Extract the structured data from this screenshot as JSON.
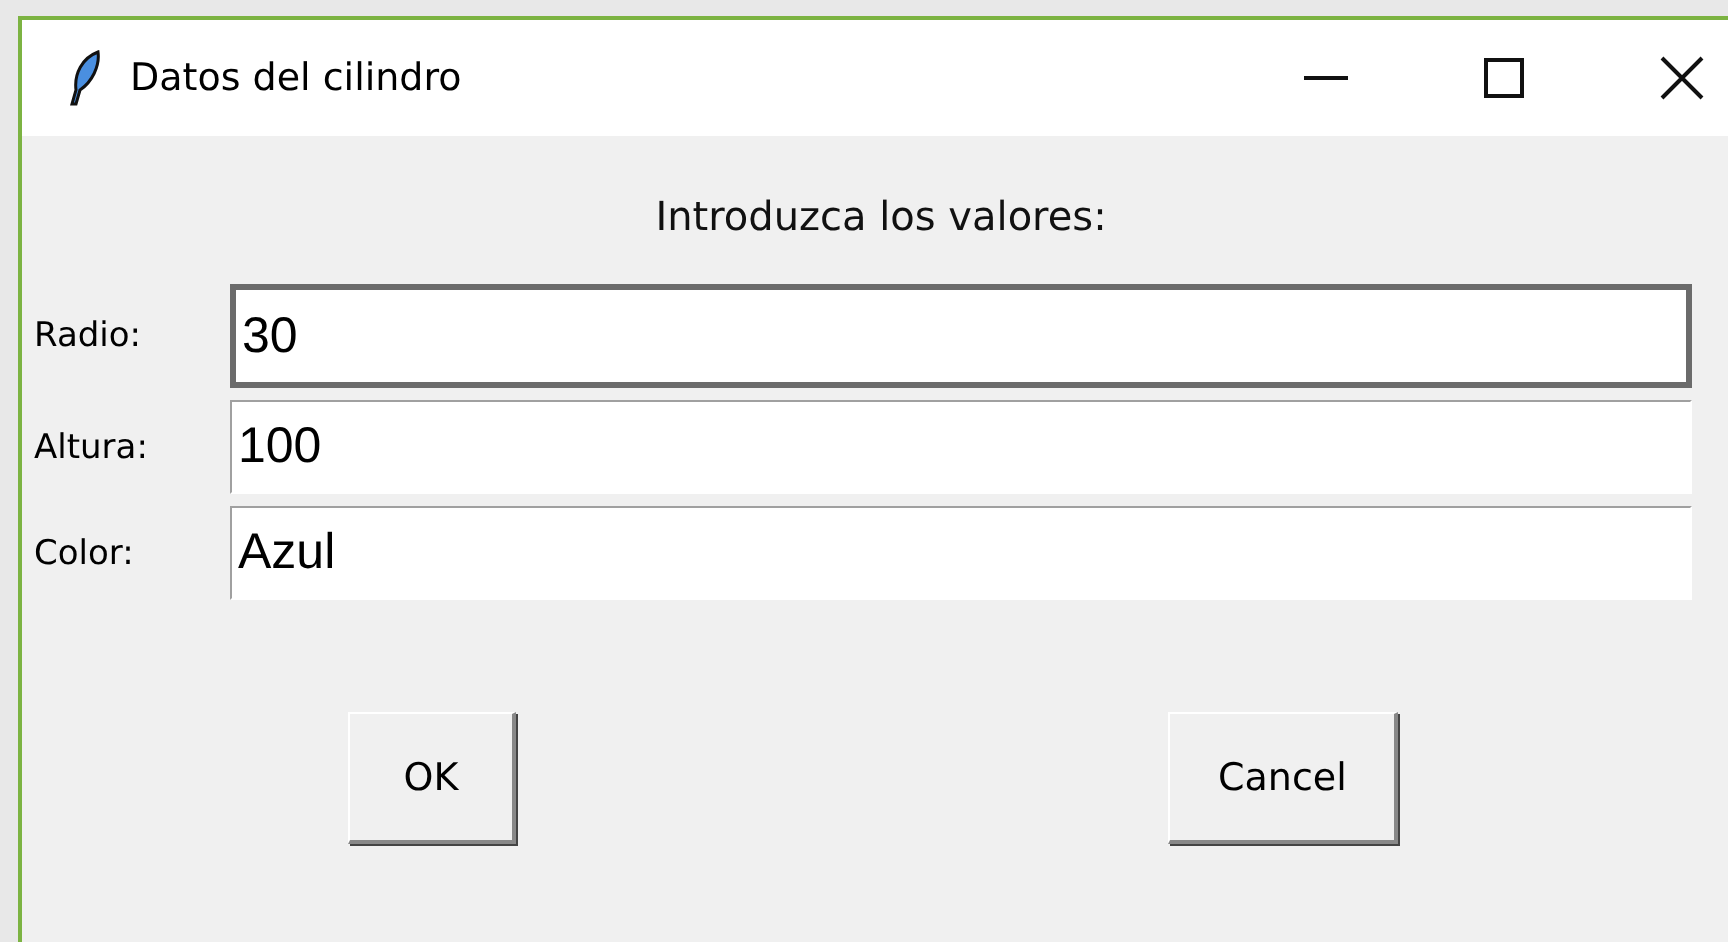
{
  "window": {
    "title": "Datos del cilindro"
  },
  "prompt": "Introduzca los valores:",
  "fields": [
    {
      "label": "Radio:",
      "value": "30",
      "focused": true
    },
    {
      "label": "Altura:",
      "value": "100",
      "focused": false
    },
    {
      "label": "Color:",
      "value": "Azul",
      "focused": false
    }
  ],
  "buttons": [
    "OK",
    "Cancel"
  ]
}
